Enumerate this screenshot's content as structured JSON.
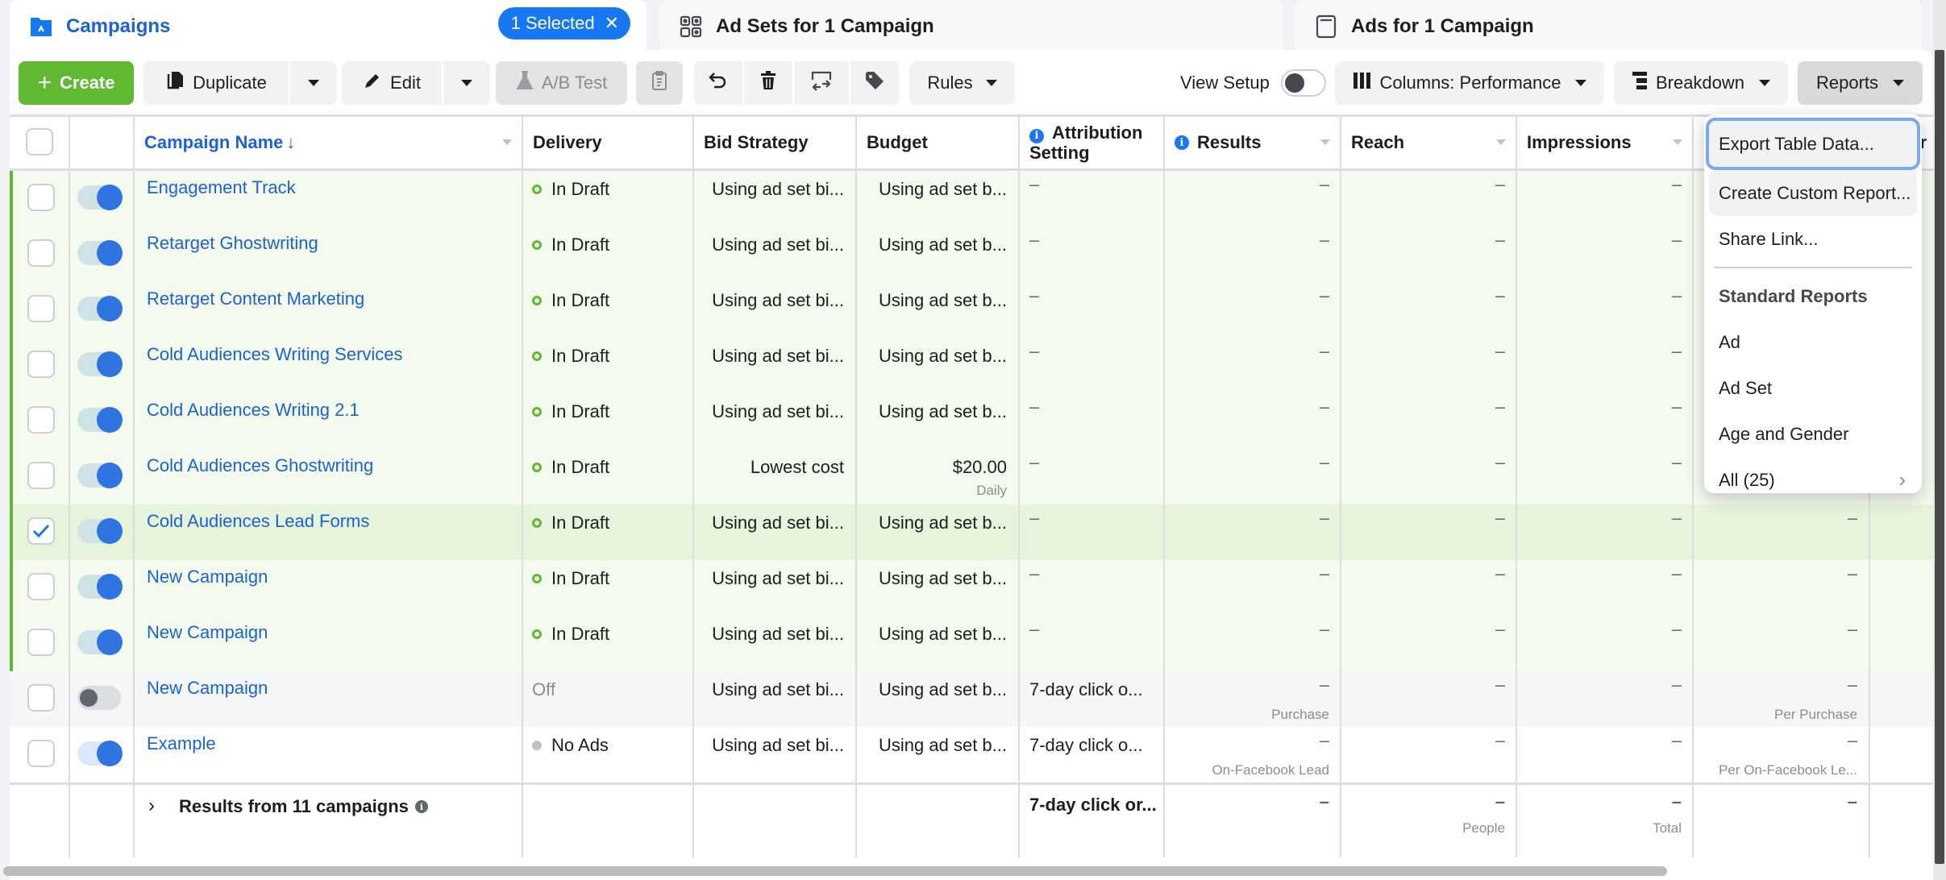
{
  "tabs": [
    {
      "label": "Campaigns",
      "icon": "campaign-folder-icon",
      "active": true
    },
    {
      "label": "Ad Sets for 1 Campaign",
      "icon": "ad-sets-grid-icon"
    },
    {
      "label": "Ads for 1 Campaign",
      "icon": "ad-window-icon"
    }
  ],
  "selection": {
    "label": "1 Selected",
    "clear": "✕"
  },
  "toolbar": {
    "create": "Create",
    "duplicate": "Duplicate",
    "edit": "Edit",
    "ab_test": "A/B Test",
    "rules": "Rules",
    "view_setup": "View Setup",
    "columns": "Columns: Performance",
    "breakdown": "Breakdown",
    "reports": "Reports"
  },
  "table": {
    "headers": {
      "name": "Campaign Name",
      "sort_arrow": "↓",
      "delivery": "Delivery",
      "bid": "Bid Strategy",
      "budget": "Budget",
      "attribution_1": "Attribution",
      "attribution_2": "Setting",
      "results": "Results",
      "reach": "Reach",
      "impressions": "Impressions",
      "cost_partial": "ur"
    },
    "rows": [
      {
        "name": "Engagement Track",
        "delivery": "In Draft",
        "bid": "Using ad set bi...",
        "budget": "Using ad set b...",
        "attribution": "–",
        "results": "–",
        "reach": "–",
        "impressions": "–",
        "cost": "–",
        "selected": false,
        "on": true
      },
      {
        "name": "Retarget Ghostwriting",
        "delivery": "In Draft",
        "bid": "Using ad set bi...",
        "budget": "Using ad set b...",
        "attribution": "–",
        "results": "–",
        "reach": "–",
        "impressions": "–",
        "cost": "–",
        "selected": false,
        "on": true
      },
      {
        "name": "Retarget Content Marketing",
        "delivery": "In Draft",
        "bid": "Using ad set bi...",
        "budget": "Using ad set b...",
        "attribution": "–",
        "results": "–",
        "reach": "–",
        "impressions": "–",
        "cost": "–",
        "selected": false,
        "on": true
      },
      {
        "name": "Cold Audiences Writing Services",
        "delivery": "In Draft",
        "bid": "Using ad set bi...",
        "budget": "Using ad set b...",
        "attribution": "–",
        "results": "–",
        "reach": "–",
        "impressions": "–",
        "cost": "–",
        "selected": false,
        "on": true
      },
      {
        "name": "Cold Audiences Writing 2.1",
        "delivery": "In Draft",
        "bid": "Using ad set bi...",
        "budget": "Using ad set b...",
        "attribution": "–",
        "results": "–",
        "reach": "–",
        "impressions": "–",
        "cost": "–",
        "selected": false,
        "on": true
      },
      {
        "name": "Cold Audiences Ghostwriting",
        "delivery": "In Draft",
        "bid": "Lowest cost",
        "budget": "$20.00",
        "budget_sub": "Daily",
        "attribution": "–",
        "results": "–",
        "reach": "–",
        "impressions": "–",
        "cost": "–",
        "selected": false,
        "on": true
      },
      {
        "name": "Cold Audiences Lead Forms",
        "delivery": "In Draft",
        "bid": "Using ad set bi...",
        "budget": "Using ad set b...",
        "attribution": "–",
        "results": "–",
        "reach": "–",
        "impressions": "–",
        "cost": "–",
        "selected": true,
        "on": true
      },
      {
        "name": "New Campaign",
        "delivery": "In Draft",
        "bid": "Using ad set bi...",
        "budget": "Using ad set b...",
        "attribution": "–",
        "results": "–",
        "reach": "–",
        "impressions": "–",
        "cost": "–",
        "selected": false,
        "on": true
      },
      {
        "name": "New Campaign",
        "delivery": "In Draft",
        "bid": "Using ad set bi...",
        "budget": "Using ad set b...",
        "attribution": "–",
        "results": "–",
        "reach": "–",
        "impressions": "–",
        "cost": "–",
        "selected": false,
        "on": true
      },
      {
        "name": "New Campaign",
        "delivery": "Off",
        "bid": "Using ad set bi...",
        "budget": "Using ad set b...",
        "attribution": "7-day click o...",
        "results": "–",
        "results_sub": "Purchase",
        "reach": "–",
        "impressions": "–",
        "cost": "–",
        "cost_sub": "Per Purchase",
        "selected": false,
        "on": false
      },
      {
        "name": "Example",
        "delivery": "No Ads",
        "bid": "Using ad set bi...",
        "budget": "Using ad set b...",
        "attribution": "7-day click o...",
        "results": "–",
        "results_sub": "On-Facebook Lead",
        "reach": "–",
        "impressions": "–",
        "cost": "–",
        "cost_sub": "Per On-Facebook Le...",
        "selected": false,
        "on": true
      }
    ],
    "footer": {
      "label": "Results from 11 campaigns",
      "attribution": "7-day click or...",
      "results": "–",
      "reach": "–",
      "reach_sub": "People",
      "impressions": "–",
      "impressions_sub": "Total",
      "cost": "–"
    }
  },
  "reports_menu": {
    "items": [
      {
        "label": "Export Table Data...",
        "state": "focused"
      },
      {
        "label": "Create Custom Report...",
        "state": "hover"
      },
      {
        "label": "Share Link..."
      }
    ],
    "section_heading": "Standard Reports",
    "standard": [
      {
        "label": "Ad"
      },
      {
        "label": "Ad Set"
      },
      {
        "label": "Age and Gender"
      },
      {
        "label": "All (25)",
        "has_submenu": true
      }
    ]
  },
  "colors": {
    "brand_blue": "#1877f2",
    "link_blue": "#1b62d4",
    "create_green": "#61b931",
    "draft_row_bg": "#f4faee",
    "selected_row_bg": "#e6f4dc"
  }
}
